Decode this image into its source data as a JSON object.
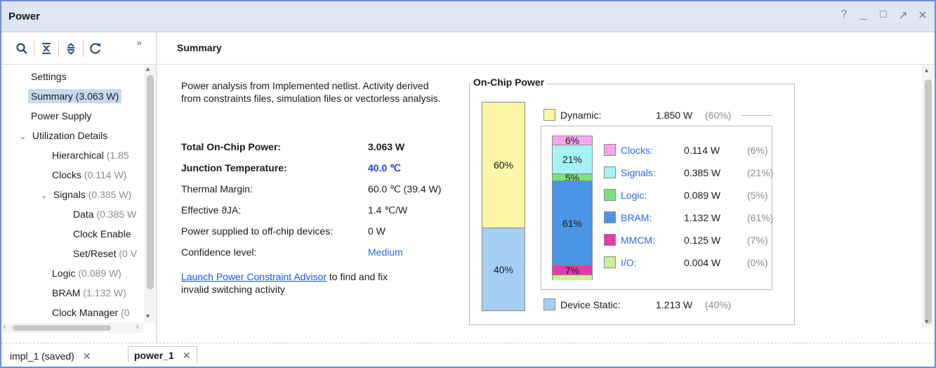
{
  "window": {
    "title": "Power"
  },
  "window_controls": {
    "help": "?",
    "minimize": "_",
    "maximize": "□",
    "restore": "↗",
    "close": "✕"
  },
  "toolbar": {
    "more": "»"
  },
  "tree": {
    "items": [
      {
        "label": "Settings"
      },
      {
        "label": "Summary (3.063 W)"
      },
      {
        "label": "Power Supply"
      },
      {
        "label": "Utilization Details"
      },
      {
        "label": "Hierarchical",
        "muted": "(1.85"
      },
      {
        "label": "Clocks",
        "muted": "(0.114 W)"
      },
      {
        "label": "Signals",
        "muted": "(0.385 W)"
      },
      {
        "label": "Data",
        "muted": "(0.385 W"
      },
      {
        "label": "Clock Enable",
        "muted": ""
      },
      {
        "label": "Set/Reset",
        "muted": "(0 V"
      },
      {
        "label": "Logic",
        "muted": "(0.089 W)"
      },
      {
        "label": "BRAM",
        "muted": "(1.132 W)"
      },
      {
        "label": "Clock Manager",
        "muted": "(0"
      }
    ]
  },
  "summary": {
    "header": "Summary",
    "intro": "Power analysis from Implemented netlist. Activity derived from constraints files, simulation files or vectorless analysis.",
    "rows": [
      {
        "key": "Total On-Chip Power:",
        "value": "3.063 W"
      },
      {
        "key": "Junction Temperature:",
        "value": "40.0 ℃"
      },
      {
        "key": "Thermal Margin:",
        "value": "60.0 ℃ (39.4 W)"
      },
      {
        "key": "Effective ϑJA:",
        "value": "1.4 ℃/W"
      },
      {
        "key": "Power supplied to off-chip devices:",
        "value": "0 W"
      },
      {
        "key": "Confidence level:",
        "value": "Medium"
      }
    ],
    "advisor_link": "Launch Power Constraint Advisor",
    "advisor_text_1": " to find and fix",
    "advisor_text_2": "invalid switching activity"
  },
  "onchip": {
    "title": "On-Chip Power",
    "dynamic": {
      "label": "Dynamic:",
      "value": "1.850 W",
      "pct": "(60%)",
      "bar_label": "60%",
      "share": 0.6
    },
    "static": {
      "label": "Device Static:",
      "value": "1.213 W",
      "pct": "(40%)",
      "bar_label": "40%",
      "share": 0.4
    },
    "breakdown": [
      {
        "name": "Clocks:",
        "value": "0.114 W",
        "pct": "(6%)",
        "bar_label": "6%",
        "color": "#f7a6f0",
        "share": 0.06
      },
      {
        "name": "Signals:",
        "value": "0.385 W",
        "pct": "(21%)",
        "bar_label": "21%",
        "color": "#a6f3f3",
        "share": 0.21
      },
      {
        "name": "Logic:",
        "value": "0.089 W",
        "pct": "(5%)",
        "bar_label": "5%",
        "color": "#7fe07a",
        "share": 0.05
      },
      {
        "name": "BRAM:",
        "value": "1.132 W",
        "pct": "(61%)",
        "bar_label": "61%",
        "color": "#4a96e6",
        "share": 0.61
      },
      {
        "name": "MMCM:",
        "value": "0.125 W",
        "pct": "(7%)",
        "bar_label": "7%",
        "color": "#e63aa8",
        "share": 0.07
      },
      {
        "name": "I/O:",
        "value": "0.004 W",
        "pct": "(0%)",
        "bar_label": "",
        "color": "#c8f09a",
        "share": 0.0
      }
    ],
    "colors": {
      "dynamic": "#fbf7a6",
      "static": "#a6cff5"
    }
  },
  "tabs": [
    {
      "label": "impl_1 (saved)",
      "close": "✕"
    },
    {
      "label": "power_1",
      "close": "✕"
    }
  ]
}
